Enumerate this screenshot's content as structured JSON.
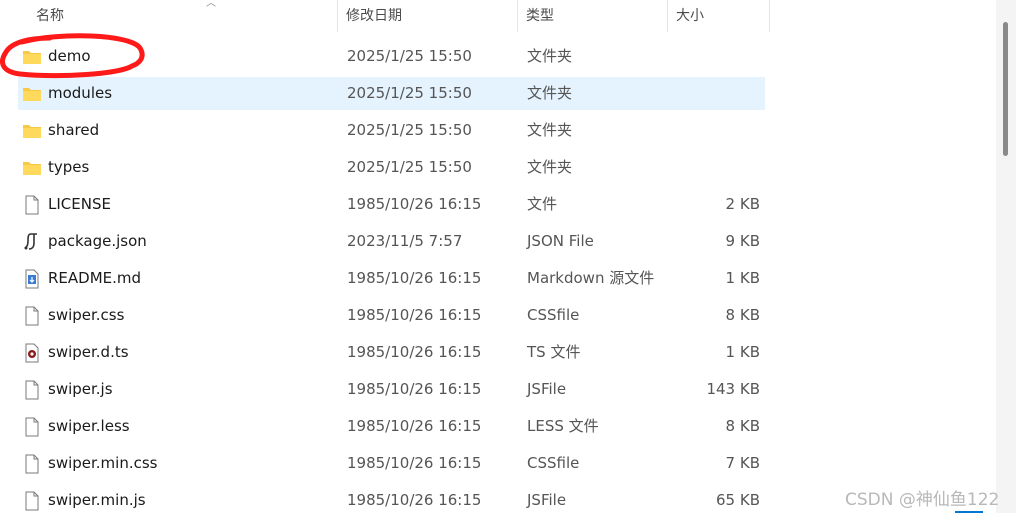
{
  "columns": {
    "name": "名称",
    "date": "修改日期",
    "type": "类型",
    "size": "大小"
  },
  "files": [
    {
      "name": "demo",
      "date": "2025/1/25 15:50",
      "type": "文件夹",
      "size": "",
      "icon": "folder-icon"
    },
    {
      "name": "modules",
      "date": "2025/1/25 15:50",
      "type": "文件夹",
      "size": "",
      "icon": "folder-icon"
    },
    {
      "name": "shared",
      "date": "2025/1/25 15:50",
      "type": "文件夹",
      "size": "",
      "icon": "folder-icon"
    },
    {
      "name": "types",
      "date": "2025/1/25 15:50",
      "type": "文件夹",
      "size": "",
      "icon": "folder-icon"
    },
    {
      "name": "LICENSE",
      "date": "1985/10/26 16:15",
      "type": "文件",
      "size": "2 KB",
      "icon": "file-icon"
    },
    {
      "name": "package.json",
      "date": "2023/11/5 7:57",
      "type": "JSON File",
      "size": "9 KB",
      "icon": "json-file-icon"
    },
    {
      "name": "README.md",
      "date": "1985/10/26 16:15",
      "type": "Markdown 源文件",
      "size": "1 KB",
      "icon": "markdown-file-icon"
    },
    {
      "name": "swiper.css",
      "date": "1985/10/26 16:15",
      "type": "CSSfile",
      "size": "8 KB",
      "icon": "file-icon"
    },
    {
      "name": "swiper.d.ts",
      "date": "1985/10/26 16:15",
      "type": "TS 文件",
      "size": "1 KB",
      "icon": "ts-file-icon"
    },
    {
      "name": "swiper.js",
      "date": "1985/10/26 16:15",
      "type": "JSFile",
      "size": "143 KB",
      "icon": "file-icon"
    },
    {
      "name": "swiper.less",
      "date": "1985/10/26 16:15",
      "type": "LESS 文件",
      "size": "8 KB",
      "icon": "file-icon"
    },
    {
      "name": "swiper.min.css",
      "date": "1985/10/26 16:15",
      "type": "CSSfile",
      "size": "7 KB",
      "icon": "file-icon"
    },
    {
      "name": "swiper.min.js",
      "date": "1985/10/26 16:15",
      "type": "JSFile",
      "size": "65 KB",
      "icon": "file-icon"
    }
  ],
  "selected_row": 1,
  "watermark": "CSDN @神仙鱼122",
  "colors": {
    "selection": "#e5f3ff",
    "folder": "#f8c848",
    "annotation": "#ff1a1a"
  }
}
